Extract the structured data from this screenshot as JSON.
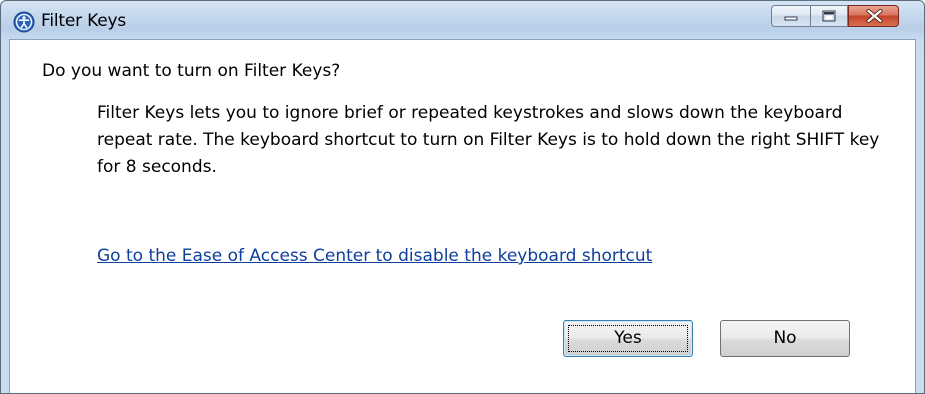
{
  "window": {
    "title": "Filter Keys",
    "icon": "ease-of-access-icon"
  },
  "caption_buttons": {
    "minimize_icon": "minimize-icon",
    "maximize_icon": "maximize-icon",
    "close_icon": "close-icon"
  },
  "dialog": {
    "question": "Do you want to turn on Filter Keys?",
    "description": "Filter Keys lets you to ignore brief or repeated keystrokes and slows down the keyboard repeat rate.  The keyboard shortcut to turn on Filter Keys is to hold down the right SHIFT key for 8 seconds.",
    "link_text": "Go to the Ease of Access Center to disable the keyboard shortcut",
    "yes_label": "Yes",
    "no_label": "No"
  },
  "colors": {
    "link": "#0d3f9c",
    "close_button": "#c4432a"
  }
}
